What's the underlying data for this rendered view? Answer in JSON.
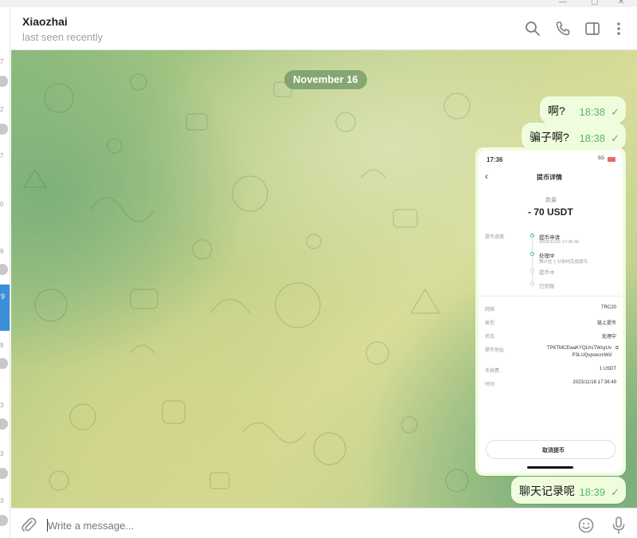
{
  "header": {
    "contact_name": "Xiaozhai",
    "status": "last seen recently",
    "icons": [
      "search-icon",
      "phone-icon",
      "sidebar-toggle-icon",
      "more-vert-icon"
    ]
  },
  "left_strip": {
    "numbers": [
      "7",
      "2",
      "7",
      "0",
      "9",
      "9",
      "9",
      "3",
      "3",
      "3"
    ],
    "active_badge": "9"
  },
  "chat": {
    "date_label": "November 16",
    "messages": [
      {
        "text": "啊?",
        "time": "18:38",
        "status": "✓"
      },
      {
        "text": "骗子啊?",
        "time": "18:38",
        "status": "✓"
      },
      {
        "text": "聊天记录呢",
        "time": "18:39",
        "status": "✓"
      }
    ],
    "screenshot": {
      "status_time": "17:36",
      "status_right": "5G",
      "back_glyph": "‹",
      "title": "提币详情",
      "amount_label": "数量",
      "amount": "- 70 USDT",
      "progress_label": "提币进度",
      "steps": [
        {
          "title": "提币申请",
          "sub": "2023/11/16 17:36:49"
        },
        {
          "title": "处理中",
          "sub": "预计在 1 分钟内完成提币"
        },
        {
          "title": "提币中",
          "sub": ""
        },
        {
          "title": "已到账",
          "sub": ""
        }
      ],
      "details": [
        {
          "label": "网络",
          "value": "TRC20"
        },
        {
          "label": "类型",
          "value": "链上提币"
        },
        {
          "label": "状态",
          "value": "处理中"
        },
        {
          "label": "提币地址",
          "value": "TPKTMCEwaKYQLhsTWsyUv",
          "value2": "P3LUQvpsecmWd"
        },
        {
          "label": "手续费",
          "value": "1 USDT"
        },
        {
          "label": "时间",
          "value": "2023/11/16 17:36:49"
        }
      ],
      "cancel_button": "取消提币"
    }
  },
  "composer": {
    "placeholder": "Write a message..."
  },
  "colors": {
    "outgoing_bubble": "#effdde",
    "check_green": "#5fb26a",
    "active_chat": "#3a8fd6"
  }
}
